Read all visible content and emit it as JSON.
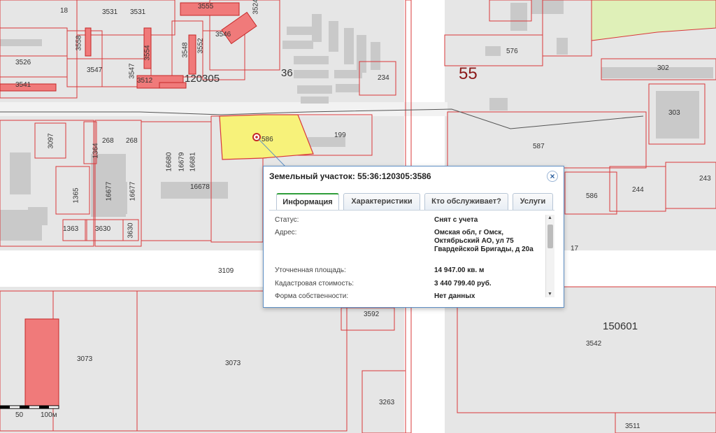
{
  "map": {
    "parcel_labels": [
      "18",
      "3531",
      "3531",
      "3555",
      "3524",
      "3558",
      "3546",
      "3552",
      "3554",
      "3548",
      "3526",
      "3547",
      "3547",
      "3541",
      "3512",
      "16680",
      "16679",
      "16681",
      "268",
      "268",
      "1364",
      "3097",
      "16677",
      "16677",
      "16678",
      "1365",
      "1363",
      "3630",
      "3630",
      "199",
      "234",
      "576",
      "302",
      "303",
      "587",
      "586",
      "244",
      "243",
      "17",
      "3109",
      "3592",
      "3542",
      "3073",
      "3073",
      "3263",
      "3511"
    ],
    "quarter_labels": [
      "120305",
      "150601"
    ],
    "district_labels": [
      "36",
      "55"
    ],
    "selected_parcel_label": "586",
    "colors": {
      "parcel_outline": "#d9383a",
      "parcel_fill_red": "#f07a7a",
      "selected_fill": "#f7f27a",
      "green_area": "#dff0b8",
      "road": "#ffffff",
      "building": "#c9c9c9"
    }
  },
  "scale": {
    "tick_50": "50",
    "tick_100": "100м"
  },
  "popup": {
    "title": "Земельный участок: 55:36:120305:3586",
    "close_icon": "close-icon",
    "tabs": [
      "Информация",
      "Характеристики",
      "Кто обслуживает?",
      "Услуги"
    ],
    "active_tab": "Информация",
    "rows": [
      {
        "label": "Статус:",
        "value": "Снят с учета"
      },
      {
        "label": "Адрес:",
        "value": "Омская обл, г Омск, Октябрьский АО, ул 75 Гвардейской Бригады, д 20а"
      },
      {
        "label": "Уточненная площадь:",
        "value": "14 947.00 кв. м"
      },
      {
        "label": "Кадастровая стоимость:",
        "value": "3 440 799.40 руб."
      },
      {
        "label": "Форма собственности:",
        "value": "Нет данных"
      }
    ]
  }
}
